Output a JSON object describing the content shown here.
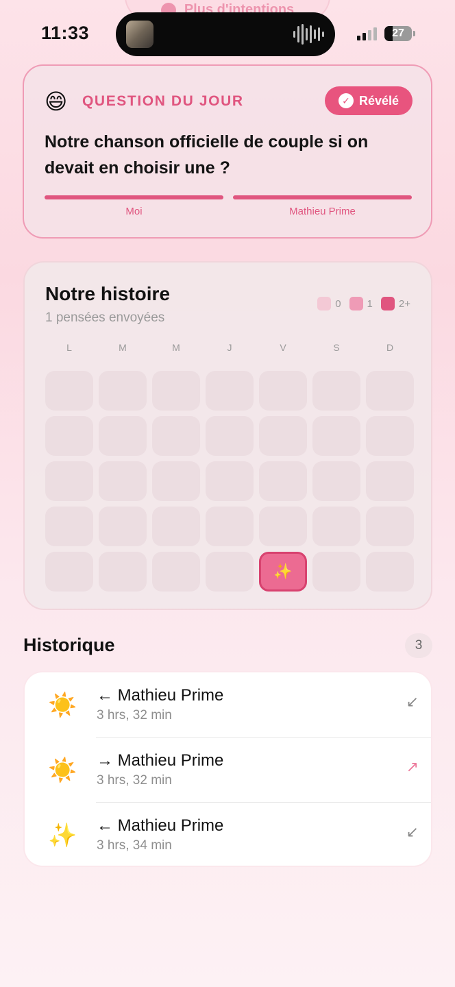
{
  "status_bar": {
    "time": "11:33",
    "battery": "27"
  },
  "background_pill": {
    "label": "Plus d'intentions"
  },
  "question_card": {
    "emoji": "😄",
    "kicker": "QUESTION DU JOUR",
    "badge_label": "Révélé",
    "question": "Notre chanson officielle de couple si on devait en choisir une ?",
    "participants": [
      "Moi",
      "Mathieu Prime"
    ],
    "accent_color": "#e0557f"
  },
  "history_card": {
    "title": "Notre histoire",
    "subtitle": "1 pensées envoyées",
    "legend": [
      {
        "label": "0",
        "color": "#f3c9d5"
      },
      {
        "label": "1",
        "color": "#ef9bb6"
      },
      {
        "label": "2+",
        "color": "#e0557f"
      }
    ],
    "weekdays": [
      "L",
      "M",
      "M",
      "J",
      "V",
      "S",
      "D"
    ],
    "grid_rows": [
      [
        "",
        "",
        "",
        "",
        "",
        "",
        ""
      ],
      [
        "",
        "",
        "",
        "",
        "",
        "",
        ""
      ],
      [
        "",
        "",
        "",
        "",
        "",
        "",
        ""
      ],
      [
        "",
        "",
        "",
        "",
        "",
        "",
        ""
      ],
      [
        "",
        "",
        "",
        "",
        "✨",
        "",
        ""
      ]
    ],
    "active_cell": {
      "row": 4,
      "col": 4
    }
  },
  "historique": {
    "title": "Historique",
    "count": "3",
    "items": [
      {
        "emoji": "☀️",
        "name": "← Mathieu Prime",
        "time": "3 hrs, 32 min",
        "direction_icon": "↙",
        "direction": "received",
        "icon_color": "#8a8a8a"
      },
      {
        "emoji": "☀️",
        "name": "→ Mathieu Prime",
        "time": "3 hrs, 32 min",
        "direction_icon": "↗",
        "direction": "sent",
        "icon_color": "#ec7a9c"
      },
      {
        "emoji": "✨",
        "name": "← Mathieu Prime",
        "time": "3 hrs, 34 min",
        "direction_icon": "↙",
        "direction": "received",
        "icon_color": "#8a8a8a"
      }
    ]
  }
}
